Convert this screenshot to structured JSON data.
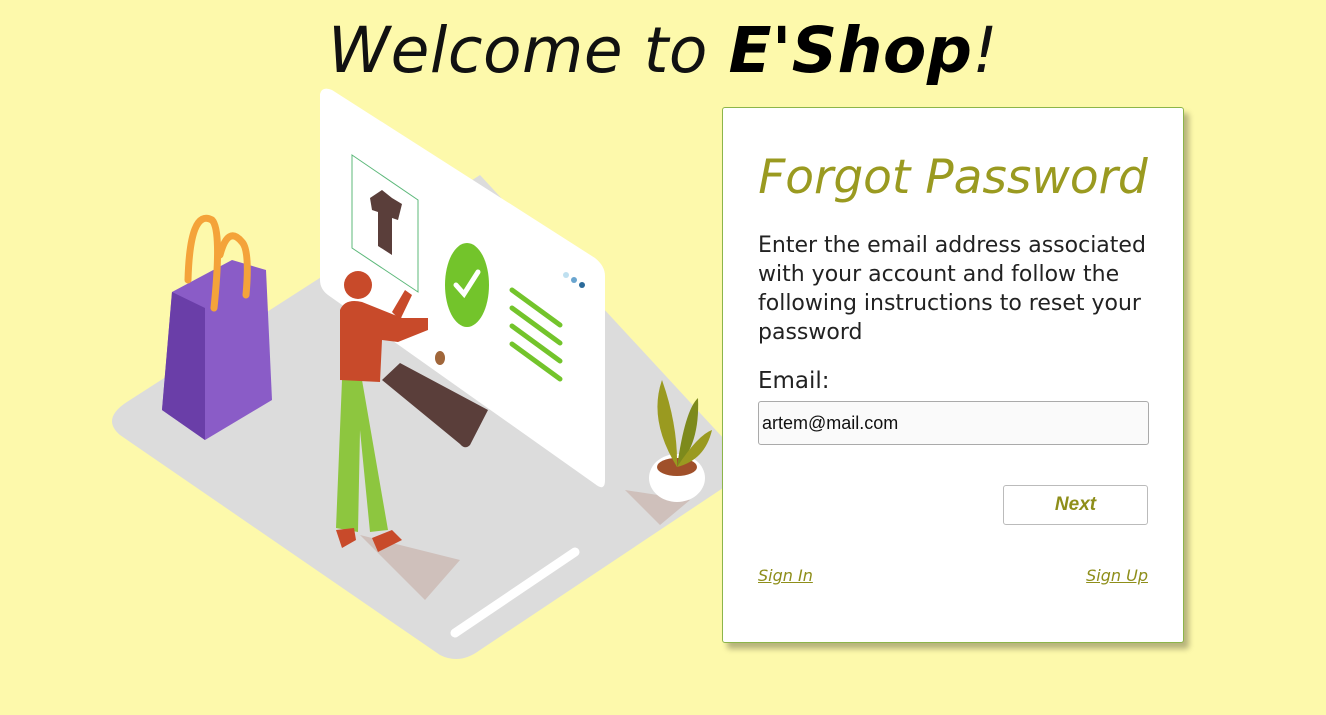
{
  "header": {
    "title_prefix": "Welcome to ",
    "brand": "E'Shop",
    "title_suffix": "!"
  },
  "form": {
    "title": "Forgot Password",
    "description": "Enter the email address associated with your account and follow the following instructions to reset your password",
    "email_label": "Email:",
    "email_value": "artem@mail.com",
    "next_label": "Next",
    "sign_in_label": "Sign In",
    "sign_up_label": "Sign Up"
  },
  "illustration": {
    "icons": [
      "shopping-bag-icon",
      "tshirt-icon",
      "checkmark-icon",
      "plant-icon"
    ]
  },
  "colors": {
    "background": "#fdf9ab",
    "accent": "#9a9a20",
    "card_border": "#8cb54a"
  }
}
